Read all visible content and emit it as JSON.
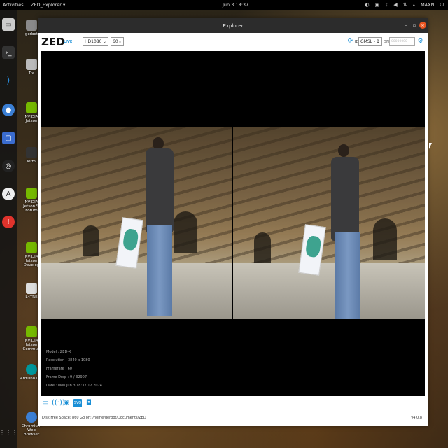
{
  "topbar": {
    "activities": "Activities",
    "app_menu": "ZED_Explorer ▾",
    "clock": "Jun 3  18:37",
    "power_mode": "MAXN"
  },
  "desktop": {
    "icons": [
      "gerbot",
      "Tra",
      "NVIDIA Jetson",
      "Termi",
      "NVIDIA Jetson Sl Forum",
      "NVIDIA Jetson Develop",
      "L4TRE",
      "NVIDIA Jetson Commun",
      "Arduino IDE",
      "Chromium Web Browser"
    ]
  },
  "window": {
    "title": "Explorer"
  },
  "toolbar": {
    "logo": "ZED",
    "live_label": "LIVE",
    "resolution": "HD1080",
    "fps": "60",
    "id_label": "ID",
    "id_value": "GMSL - 0",
    "sn_label": "SN",
    "sn_placeholder": "00000000"
  },
  "info": {
    "model": "Model : ZED-X",
    "resolution": "Resolution : 3840 x 1080",
    "framerate": "Framerate : 60",
    "frame_drop": "Frame Drop : 9 / 32907",
    "date": "Date : Mon Jun 3 18:37:12 2024"
  },
  "status": {
    "disk": "Disk Free Space: 860 Gb  on: /home/gerbot/Documents/ZED",
    "version": "v4.0.8"
  },
  "colors": {
    "accent": "#1a8fd6",
    "close": "#e95420"
  }
}
